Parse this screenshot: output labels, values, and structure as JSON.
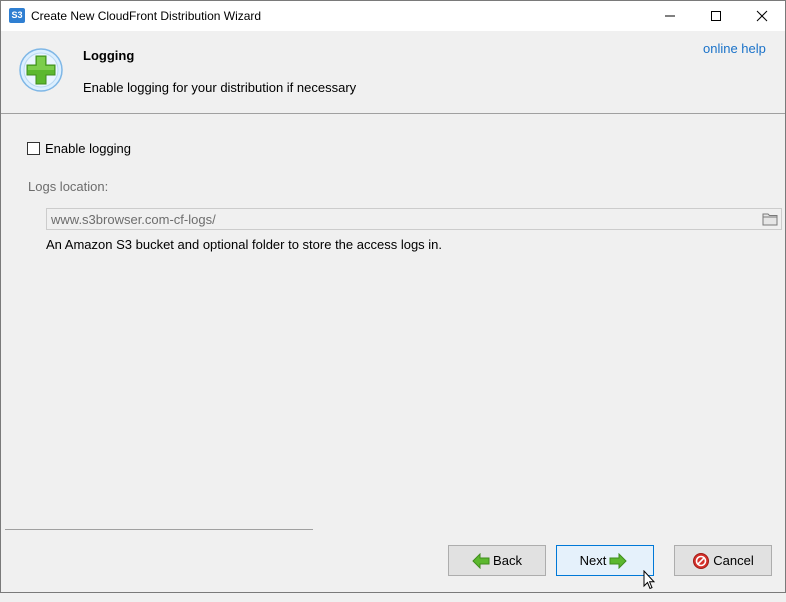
{
  "window": {
    "title": "Create New CloudFront Distribution Wizard",
    "app_icon_text": "S3"
  },
  "header": {
    "title": "Logging",
    "description": "Enable logging for your distribution if necessary",
    "help_link": "online help"
  },
  "logging": {
    "enable_label": "Enable logging",
    "enabled": false,
    "location_label": "Logs location:",
    "location_value": "www.s3browser.com-cf-logs/",
    "hint": "An Amazon S3 bucket and optional folder to store the access logs in."
  },
  "buttons": {
    "back": "Back",
    "next": "Next",
    "cancel": "Cancel"
  },
  "icons": {
    "logo": "green-plus-icon",
    "folder": "folder-icon",
    "back": "green-arrow-left-icon",
    "next": "green-arrow-right-icon",
    "cancel": "red-cancel-icon"
  },
  "colors": {
    "link": "#1a72c9",
    "focus_border": "#0078d7",
    "logo_green": "#5cb82e",
    "cancel_red": "#d4302a"
  }
}
